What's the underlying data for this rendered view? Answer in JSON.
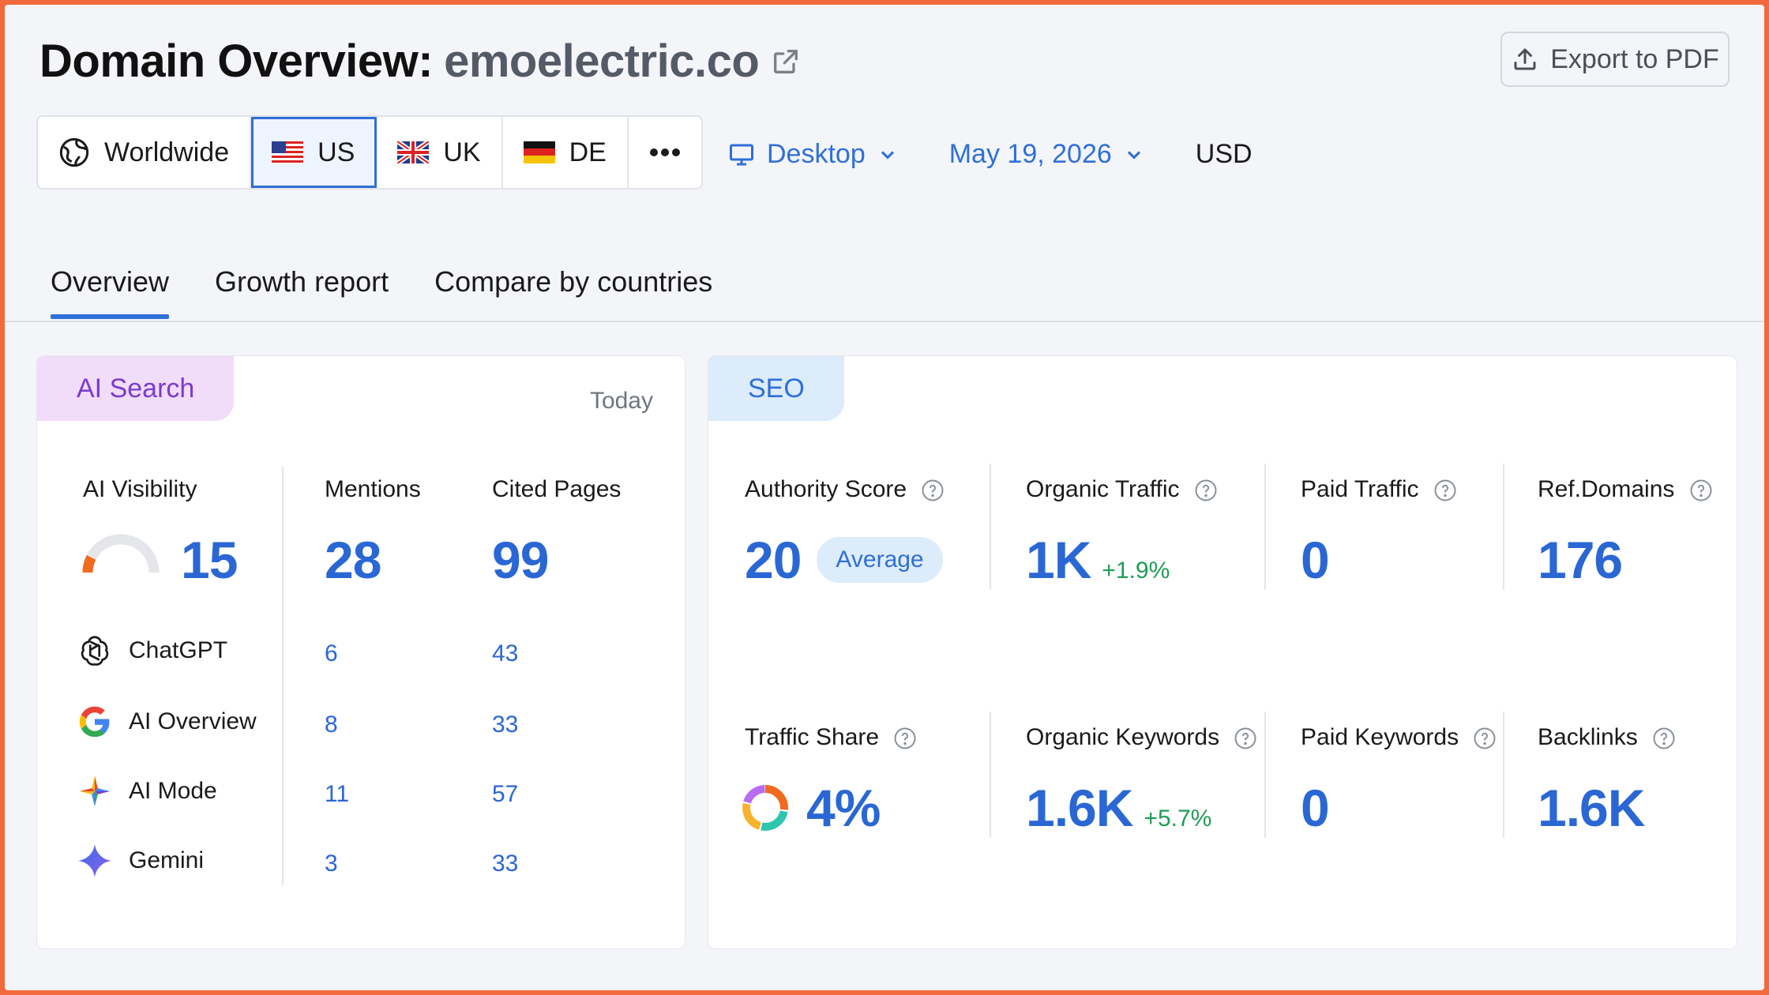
{
  "header": {
    "title_prefix": "Domain Overview:",
    "domain": "emoelectric.co",
    "export_label": "Export to PDF"
  },
  "regions": [
    {
      "label": "Worldwide",
      "icon": "globe-icon",
      "active": false
    },
    {
      "label": "US",
      "icon": "us-flag-icon",
      "active": true
    },
    {
      "label": "UK",
      "icon": "uk-flag-icon",
      "active": false
    },
    {
      "label": "DE",
      "icon": "de-flag-icon",
      "active": false
    }
  ],
  "controls": {
    "device": "Desktop",
    "date": "May 19, 2026",
    "currency": "USD"
  },
  "tabs": [
    {
      "label": "Overview",
      "active": true
    },
    {
      "label": "Growth report",
      "active": false
    },
    {
      "label": "Compare by countries",
      "active": false
    }
  ],
  "ai_search": {
    "tag": "AI Search",
    "period": "Today",
    "visibility_label": "AI Visibility",
    "visibility_value": "15",
    "visibility_gauge_fraction": 0.15,
    "mentions_label": "Mentions",
    "mentions_total": "28",
    "cited_label": "Cited Pages",
    "cited_total": "99",
    "engines": [
      {
        "name": "ChatGPT",
        "icon": "chatgpt-icon",
        "mentions": "6",
        "cited": "43"
      },
      {
        "name": "AI Overview",
        "icon": "google-icon",
        "mentions": "8",
        "cited": "33"
      },
      {
        "name": "AI Mode",
        "icon": "ai-mode-icon",
        "mentions": "11",
        "cited": "57"
      },
      {
        "name": "Gemini",
        "icon": "gemini-icon",
        "mentions": "3",
        "cited": "33"
      }
    ]
  },
  "seo": {
    "tag": "SEO",
    "authority_label": "Authority Score",
    "authority_value": "20",
    "authority_badge": "Average",
    "organic_traffic_label": "Organic Traffic",
    "organic_traffic_value": "1K",
    "organic_traffic_delta": "+1.9%",
    "paid_traffic_label": "Paid Traffic",
    "paid_traffic_value": "0",
    "ref_domains_label": "Ref.Domains",
    "ref_domains_value": "176",
    "traffic_share_label": "Traffic Share",
    "traffic_share_value": "4%",
    "organic_keywords_label": "Organic Keywords",
    "organic_keywords_value": "1.6K",
    "organic_keywords_delta": "+5.7%",
    "paid_keywords_label": "Paid Keywords",
    "paid_keywords_value": "0",
    "backlinks_label": "Backlinks",
    "backlinks_value": "1.6K"
  },
  "colors": {
    "accent": "#2f6fd8",
    "positive": "#1f9c55",
    "ai_tag_bg": "#f1dcf9",
    "seo_tag_bg": "#dcecfb",
    "frame_border": "#f26a3b"
  }
}
